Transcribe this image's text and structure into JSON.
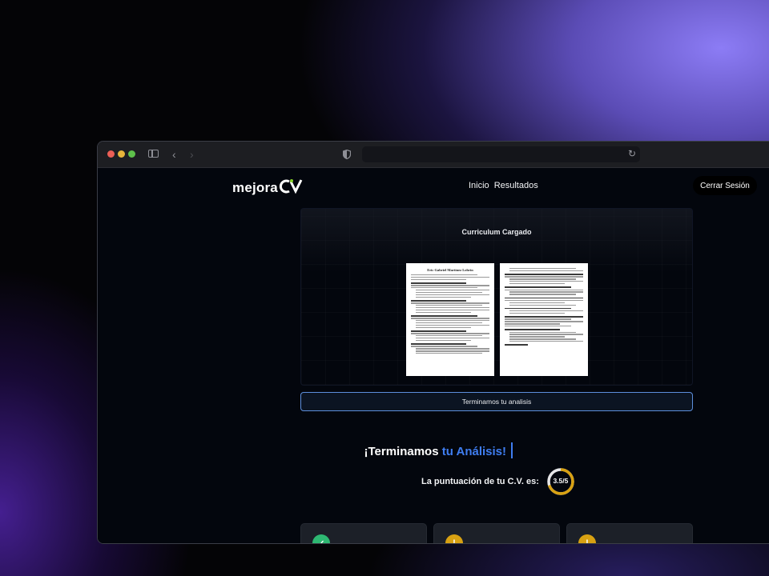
{
  "app": {
    "logo_text": "mejora",
    "logo_cv": "CV"
  },
  "nav": {
    "items": [
      "Inicio",
      "Resultados"
    ]
  },
  "header": {
    "logout_label": "Cerrar Sesión"
  },
  "cv_panel": {
    "title": "Curriculum Cargado",
    "document_name": "Eric Gabriel Martinez Lobrin"
  },
  "status": {
    "message": "Terminamos tu analisis"
  },
  "result": {
    "heading_main": "¡Terminamos",
    "heading_accent": "tu Análisis!",
    "score_label": "La puntuación de tu C.V. es:",
    "score_text": "3.5/5",
    "score_value": 3.5,
    "score_max": 5
  },
  "cards": [
    {
      "icon": "check-icon",
      "color": "#2eb872"
    },
    {
      "icon": "warning-icon",
      "color": "#d8a112"
    },
    {
      "icon": "warning-icon",
      "color": "#d8a112"
    }
  ],
  "colors": {
    "accent": "#3f7df0",
    "score_ring": "#d8a112"
  }
}
